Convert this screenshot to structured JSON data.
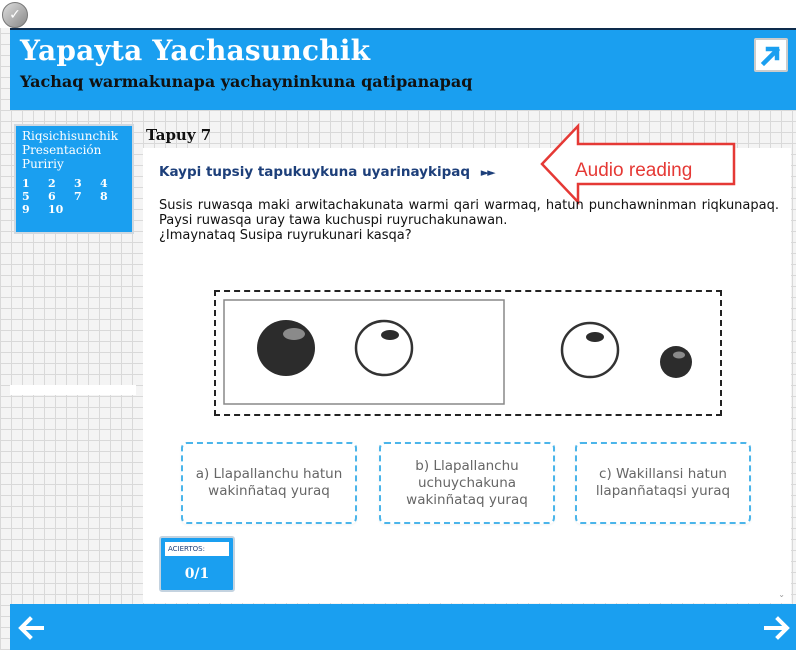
{
  "header": {
    "title": "Yapayta Yachasunchik",
    "subtitle": "Yachaq warmakunapa yachayninkuna qatipanapaq"
  },
  "sidebar": {
    "links": [
      "Riqsichisunchik",
      "Presentación",
      "Puririy"
    ],
    "pages": [
      "1",
      "2",
      "3",
      "4",
      "5",
      "6",
      "7",
      "8",
      "9",
      "10"
    ]
  },
  "page": {
    "heading": "Tapuy 7"
  },
  "activity": {
    "instruction": "Kaypi tupsiy tapukuykuna uyarinaykipaq",
    "play_glyph": "►►",
    "callout": "Audio reading",
    "question_line1": "Susis ruwasqa maki arwitachakunata warmi qari warmaq, hatun punchawninman riqkunapaq. Paysi ruwasqa uray tawa kuchuspi ruyruchakunawan.",
    "question_line2": "¿Imaynataq Susipa ruyrukunari kasqa?",
    "options": [
      {
        "label": "a) Llapallanchu hatun wakinñataq yuraq"
      },
      {
        "label": "b) Llapallanchu uchuychakuna wakinñataq yuraq"
      },
      {
        "label": "c) Wakillansi hatun llapanñataqsi yuraq"
      }
    ]
  },
  "score": {
    "label": "ACIERTOS:",
    "value": "0/1"
  },
  "colors": {
    "primary": "#1a9ff0",
    "callout": "#e53935",
    "instruction": "#1d3f7a"
  },
  "icons": {
    "expand": "expand-arrow-icon",
    "prev": "arrow-left-icon",
    "next": "arrow-right-icon",
    "corner": "check-badge-icon"
  }
}
